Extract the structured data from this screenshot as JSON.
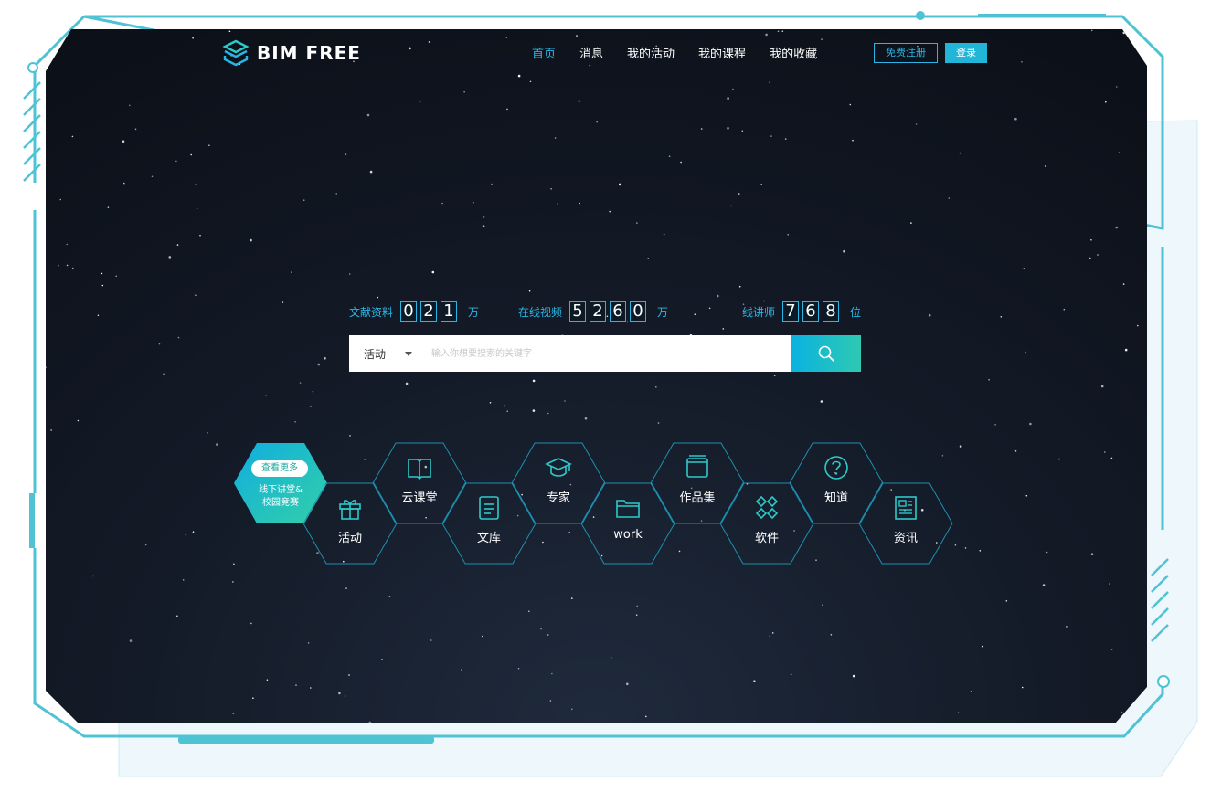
{
  "brand": {
    "logo_text": "BIM FREE"
  },
  "nav": {
    "items": [
      "首页",
      "消息",
      "我的活动",
      "我的课程",
      "我的收藏"
    ],
    "active_index": 0
  },
  "auth": {
    "register_label": "免费注册",
    "login_label": "登录"
  },
  "stats": [
    {
      "label": "文献资料",
      "digits": [
        "0",
        "2",
        "1"
      ],
      "unit": "万"
    },
    {
      "label": "在线视频",
      "digits": [
        "5",
        "2",
        "6",
        "0"
      ],
      "unit": "万"
    },
    {
      "label": "一线讲师",
      "digits": [
        "7",
        "6",
        "8"
      ],
      "unit": "位"
    }
  ],
  "search": {
    "category": "活动",
    "placeholder": "输入你想要搜索的关键字",
    "button_icon": "search-icon"
  },
  "feature": {
    "button_label": "查看更多",
    "line1": "线下讲堂&",
    "line2": "校园竞赛"
  },
  "categories": [
    {
      "label": "活动",
      "icon": "gift-icon"
    },
    {
      "label": "云课堂",
      "icon": "book-icon"
    },
    {
      "label": "文库",
      "icon": "document-icon"
    },
    {
      "label": "专家",
      "icon": "graduation-cap-icon"
    },
    {
      "label": "work",
      "icon": "folder-icon"
    },
    {
      "label": "作品集",
      "icon": "portfolio-icon"
    },
    {
      "label": "软件",
      "icon": "apps-icon"
    },
    {
      "label": "知道",
      "icon": "question-icon"
    },
    {
      "label": "资讯",
      "icon": "news-icon"
    }
  ],
  "colors": {
    "accent": "#29b6e6",
    "teal": "#2ec9b2",
    "frame": "#4fc3d3",
    "background": "#0b0f17"
  }
}
